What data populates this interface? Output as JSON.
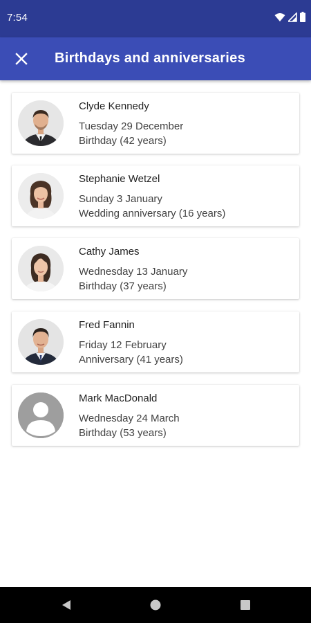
{
  "status_bar": {
    "time": "7:54"
  },
  "app_bar": {
    "title": "Birthdays and anniversaries",
    "close_icon": "close-icon"
  },
  "colors": {
    "status_bar": "#2c3b93",
    "app_bar": "#3b4db6",
    "nav_bar": "#000000"
  },
  "events": [
    {
      "name": "Clyde Kennedy",
      "date": "Tuesday 29 December",
      "event": "Birthday (42 years)"
    },
    {
      "name": "Stephanie Wetzel",
      "date": "Sunday 3 January",
      "event": "Wedding anniversary (16 years)"
    },
    {
      "name": "Cathy James",
      "date": "Wednesday 13 January",
      "event": "Birthday (37 years)"
    },
    {
      "name": "Fred Fannin",
      "date": "Friday 12 February",
      "event": "Anniversary (41 years)"
    },
    {
      "name": "Mark MacDonald",
      "date": "Wednesday 24 March",
      "event": "Birthday (53 years)"
    }
  ],
  "nav": {
    "back_icon": "back-triangle-icon",
    "home_icon": "home-circle-icon",
    "recents_icon": "recents-square-icon"
  }
}
